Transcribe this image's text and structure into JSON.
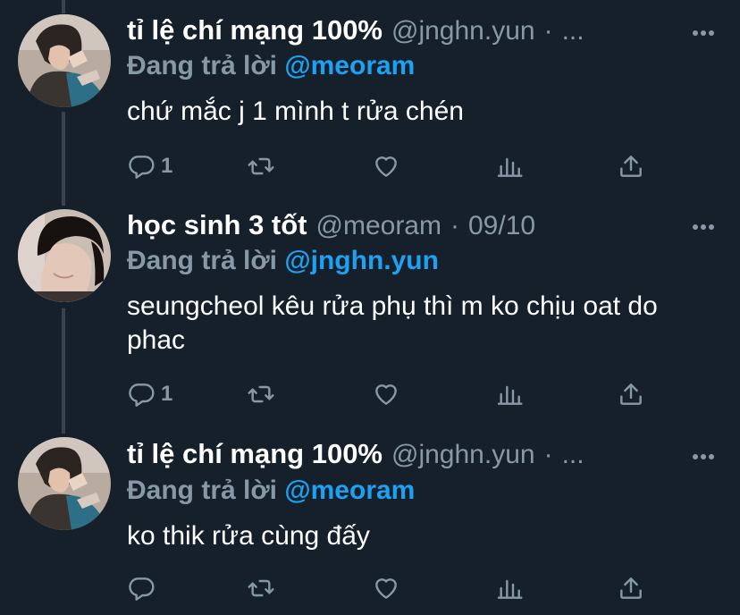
{
  "colors": {
    "background": "#15202b",
    "text": "#ffffff",
    "muted": "#8899a6",
    "link": "#1da1f2",
    "thread_line": "#38444d"
  },
  "tweets": [
    {
      "display_name": "tỉ lệ chí mạng 100%",
      "handle": "@jnghn.yun",
      "separator": "·",
      "timestamp": "...",
      "reply_label": "Đang trả lời",
      "reply_mention": "@meoram",
      "text": "chứ mắc j 1 mình t rửa chén",
      "reply_count": "1",
      "icons": [
        "reply-icon",
        "retweet-icon",
        "like-icon",
        "analytics-icon",
        "share-icon",
        "more-icon"
      ]
    },
    {
      "display_name": "học sinh 3 tốt",
      "handle": "@meoram",
      "separator": "·",
      "timestamp": "09/10",
      "reply_label": "Đang trả lời",
      "reply_mention": "@jnghn.yun",
      "text": "seungcheol kêu rửa phụ thì m ko chịu oat do phac",
      "reply_count": "1",
      "icons": [
        "reply-icon",
        "retweet-icon",
        "like-icon",
        "analytics-icon",
        "share-icon",
        "more-icon"
      ]
    },
    {
      "display_name": "tỉ lệ chí mạng 100%",
      "handle": "@jnghn.yun",
      "separator": "·",
      "timestamp": "...",
      "reply_label": "Đang trả lời",
      "reply_mention": "@meoram",
      "text": "ko thik rửa cùng đấy",
      "reply_count": "",
      "icons": [
        "reply-icon",
        "retweet-icon",
        "like-icon",
        "analytics-icon",
        "share-icon",
        "more-icon"
      ]
    }
  ]
}
